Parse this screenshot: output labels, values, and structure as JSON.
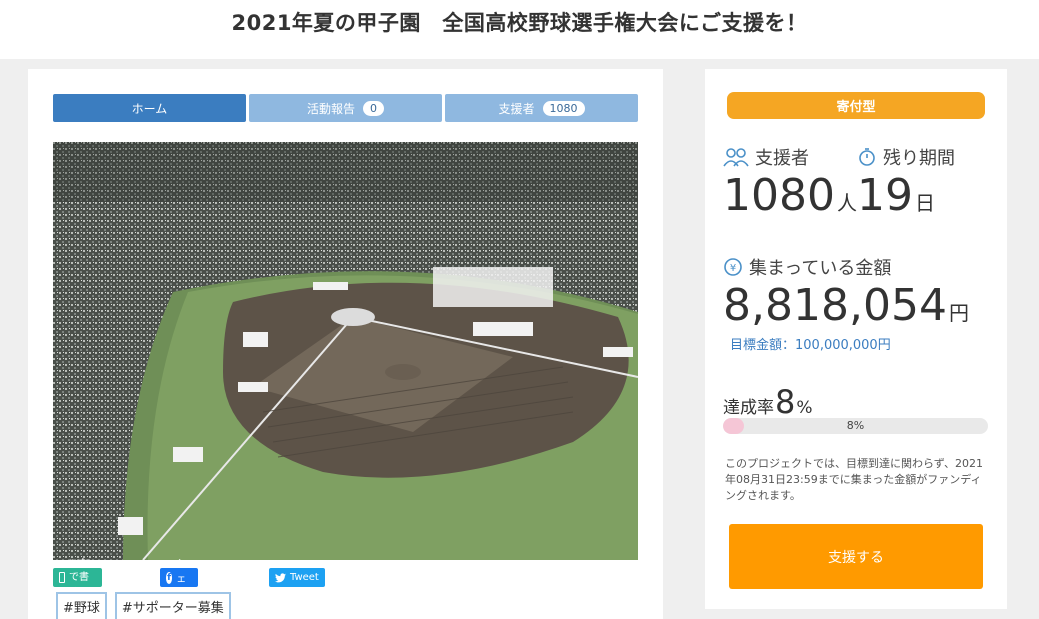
{
  "page": {
    "title": "2021年夏の甲子園　全国高校野球選手権大会にご支援を！"
  },
  "tabs": [
    {
      "label": "ホーム"
    },
    {
      "label": "活動報告",
      "count": "0"
    },
    {
      "label": "支援者",
      "count": "1080"
    }
  ],
  "share": {
    "note_label": "noteで書く",
    "facebook_label": "シェア",
    "twitter_label": "Tweet"
  },
  "tags": [
    "#野球",
    "#サポーター募集"
  ],
  "sidebar": {
    "type_label": "寄付型",
    "supporters_label": "支援者",
    "supporters_value": "1080",
    "supporters_unit": "人",
    "remaining_label": "残り期間",
    "remaining_value": "19",
    "remaining_unit": "日",
    "amount_label": "集まっている金額",
    "amount_value": "8,818,054",
    "amount_unit": "円",
    "goal_text": "目標金額：100,000,000円",
    "rate_prefix": "達成率",
    "rate_value": "8",
    "rate_suffix": "%",
    "progress_fraction": 0.08,
    "progress_text": "8%",
    "note_text": "このプロジェクトでは、目標到達に関わらず、2021年08月31日23:59までに集まった金額がファンディングされます。",
    "support_button": "支援する"
  },
  "colors": {
    "tab_active": "#3b7dc0",
    "tab_inactive": "#8fb8e0",
    "type_badge": "#f5a623",
    "support_button": "#ff9a00",
    "progress_fill": "#f5c6d6"
  }
}
